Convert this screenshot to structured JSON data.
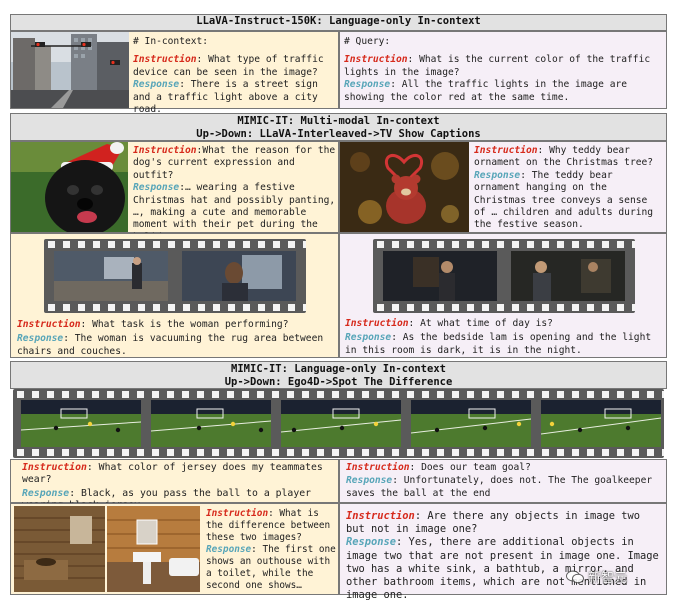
{
  "sec1": {
    "header": "LLaVA-Instruct-150K: Language-only In-context",
    "left": {
      "label": "# In-context:",
      "ins_tag": "Instruction",
      "ins_text": ": What type of traffic device can be seen in the image?",
      "rsp_tag": "Response",
      "rsp_text": ": There is a street sign and a traffic light above a city road."
    },
    "right": {
      "label": "# Query:",
      "ins_tag": "Instruction",
      "ins_text": ": What is the current color of the traffic lights in the image?",
      "rsp_tag": "Response",
      "rsp_text": ": All the traffic lights in the image are showing the color red at the same time."
    }
  },
  "sec2": {
    "header1": "MIMIC-IT: Multi-modal In-context",
    "header2": "Up->Down: LLaVA-Interleaved->TV Show Captions",
    "dog": {
      "ins_tag": "Instruction",
      "ins_text": ":What the reason for the dog's current expression and outfit?",
      "rsp_tag": "Response",
      "rsp_text": ":… wearing a festive Christmas hat and possibly panting, …, making a cute and memorable moment with their pet during the holiday season."
    },
    "bear": {
      "ins_tag": "Instruction",
      "ins_text": ": Why teddy bear ornament on the Christmas tree?",
      "rsp_tag": "Response",
      "rsp_text": ": The teddy bear ornament hanging on the Christmas tree conveys a sense of … children and adults during the festive season."
    },
    "tv1": {
      "ins_tag": "Instruction",
      "ins_text": ": What task is the woman performing?",
      "rsp_tag": "Response",
      "rsp_text": ": The woman is vacuuming the rug area between chairs and couches."
    },
    "tv2": {
      "ins_tag": "Instruction",
      "ins_text": ": At what time of day is?",
      "rsp_tag": "Response",
      "rsp_text": ": As the bedside lam is opening and the light in this room is dark, it is in the night."
    }
  },
  "sec3": {
    "header1": "MIMIC-IT: Language-only In-context",
    "header2": "Up->Down: Ego4D->Spot The Difference",
    "ego1": {
      "ins_tag": "Instruction",
      "ins_text": ": What color of jersey does my teammates wear?",
      "rsp_tag": "Response",
      "rsp_text": ": Black, as you pass the ball to a player wearing black jersey."
    },
    "ego2": {
      "ins_tag": "Instruction",
      "ins_text": ": Does our team goal?",
      "rsp_tag": "Response",
      "rsp_text": ": Unfortunately, does not. The The goalkeeper saves the ball at the end"
    },
    "diff1": {
      "ins_tag": "Instruction",
      "ins_text": ": What is the difference between these two images?",
      "rsp_tag": "Response",
      "rsp_text": ": The first one shows an outhouse with a toilet, while the second one shows…"
    },
    "diff2": {
      "ins_tag": "Instruction",
      "ins_text": ": Are there any objects in image two but not in image one?",
      "rsp_tag": "Response",
      "rsp_text": ": Yes, there are additional objects in image two that are not present in image one. Image two has a white sink, a bathtub, a mirror, and other bathroom items, which are not mentioned in image one."
    }
  },
  "watermark": "新智元",
  "colors": {
    "instruction": "#d62a1c",
    "response": "#57a5b8",
    "context_bg": "#fff3d6",
    "query_bg": "#f6eff7",
    "header_bg": "#e2e2e2"
  }
}
